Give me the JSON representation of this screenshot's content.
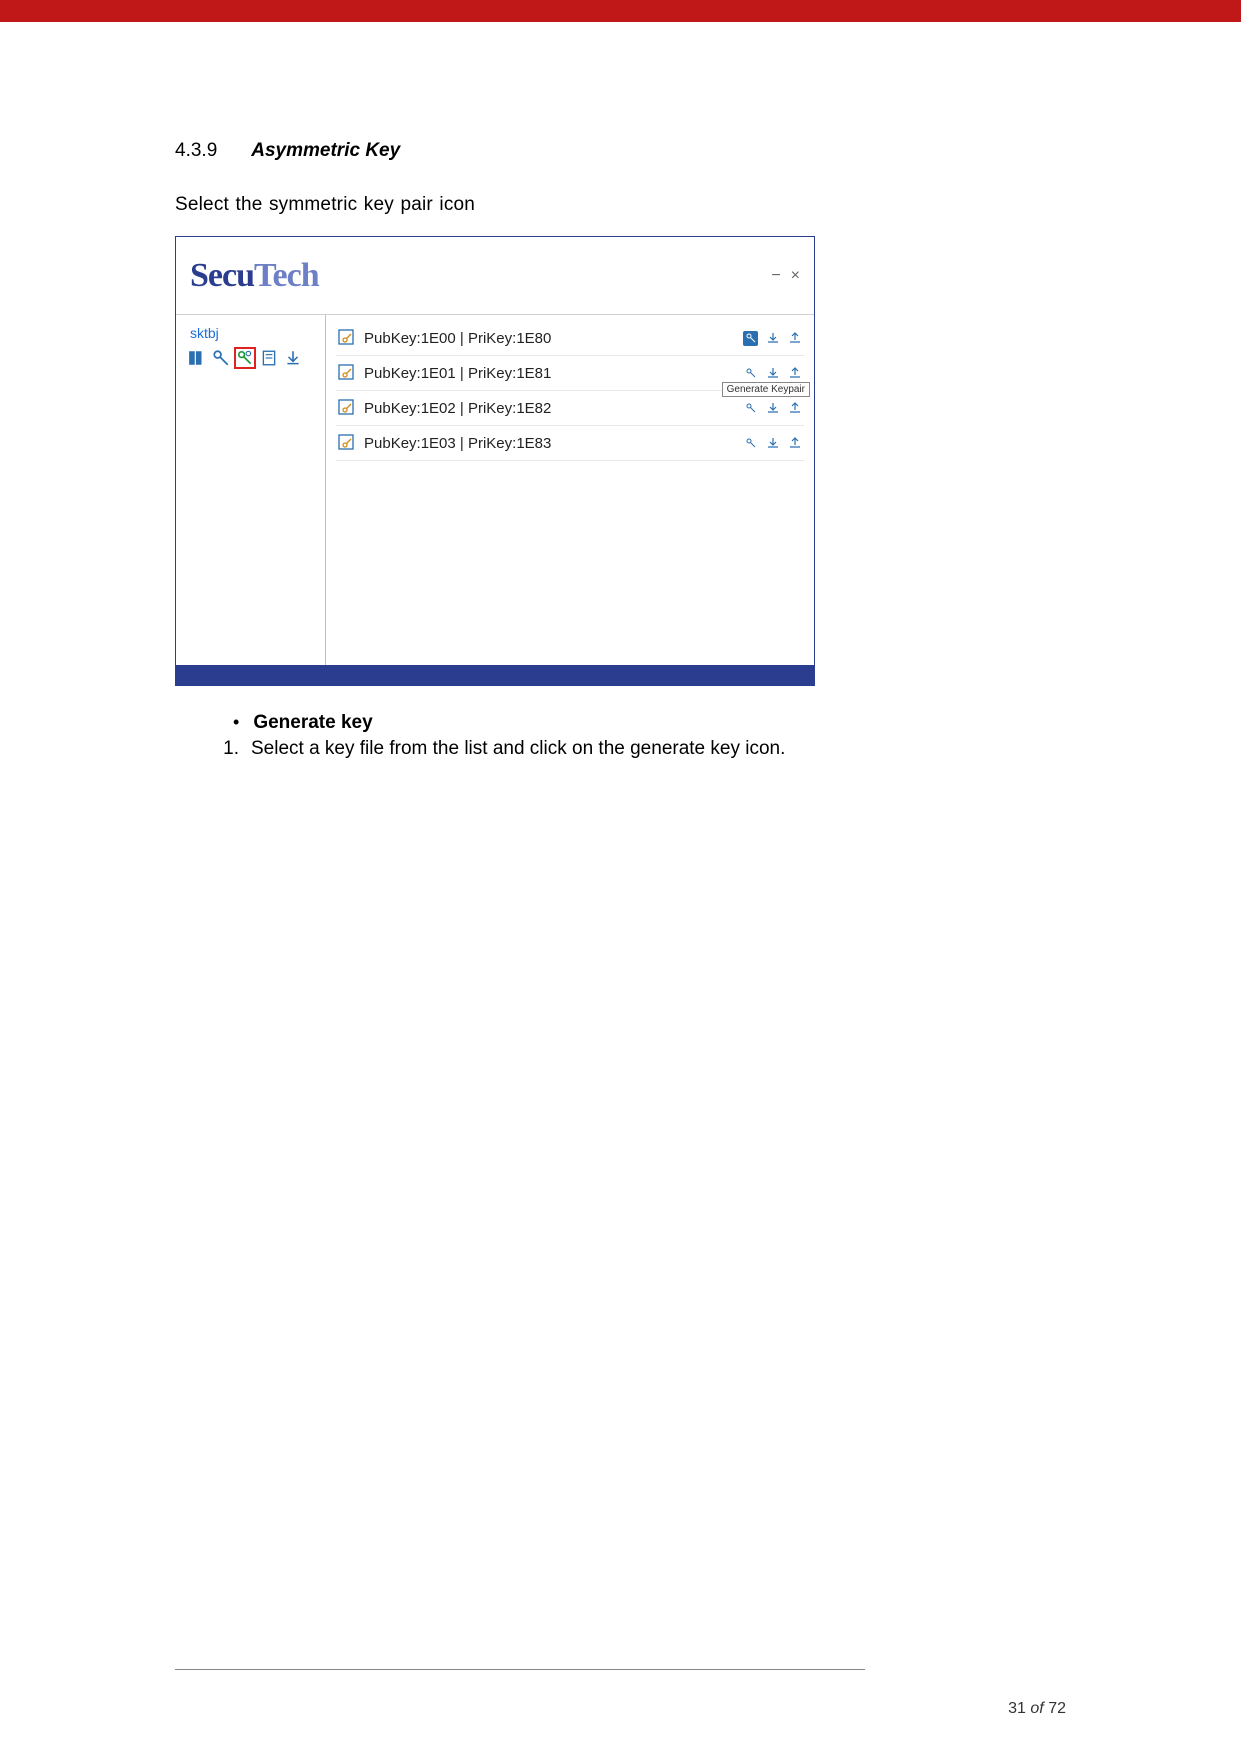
{
  "section": {
    "number": "4.3.9",
    "title": "Asymmetric Key"
  },
  "intro": "Select the symmetric key pair icon",
  "app": {
    "logo_main": "Secu",
    "logo_sub": "Tech",
    "win": {
      "min": "−",
      "close": "×"
    },
    "sidebar": {
      "label": "sktbj",
      "icons": [
        "users",
        "key",
        "keypair",
        "doc",
        "download"
      ]
    },
    "rows": [
      {
        "label": "PubKey:1E00 | PriKey:1E80",
        "tooltip": "Generate Keypair",
        "selected": true
      },
      {
        "label": "PubKey:1E01 | PriKey:1E81",
        "tooltip": "Generate Keypair",
        "selected": false
      },
      {
        "label": "PubKey:1E02 | PriKey:1E82",
        "tooltip": null,
        "selected": false
      },
      {
        "label": "PubKey:1E03 | PriKey:1E83",
        "tooltip": null,
        "selected": false
      }
    ]
  },
  "below": {
    "bullet": "Generate key",
    "step": "Select a key file from the list and click on the generate key icon."
  },
  "footer": {
    "page": "31",
    "of": "of",
    "total": "72"
  }
}
